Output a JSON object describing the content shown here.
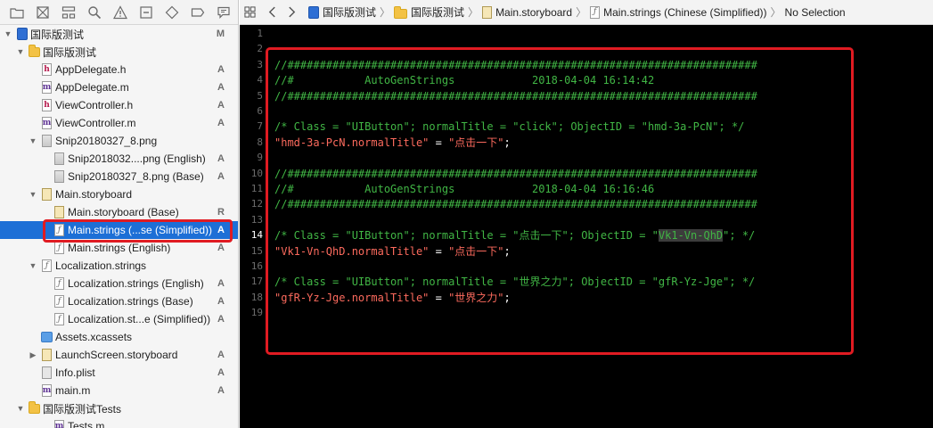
{
  "navigator": {
    "toolbar_icons": [
      "folder-icon",
      "source-control-icon",
      "hierarchy-icon",
      "search-icon",
      "warning-icon",
      "test-icon",
      "debug-icon",
      "breakpoint-icon",
      "report-icon"
    ],
    "items": [
      {
        "label": "国际版测试",
        "badge": "M",
        "icon": "project-icon",
        "disclosure": "open"
      },
      {
        "label": "国际版测试",
        "badge": "",
        "icon": "folder-icon",
        "disclosure": "open"
      },
      {
        "label": "AppDelegate.h",
        "badge": "A",
        "icon": "header-file-icon",
        "disclosure": ""
      },
      {
        "label": "AppDelegate.m",
        "badge": "A",
        "icon": "objc-file-icon",
        "disclosure": ""
      },
      {
        "label": "ViewController.h",
        "badge": "A",
        "icon": "header-file-icon",
        "disclosure": ""
      },
      {
        "label": "ViewController.m",
        "badge": "A",
        "icon": "objc-file-icon",
        "disclosure": ""
      },
      {
        "label": "Snip20180327_8.png",
        "badge": "",
        "icon": "image-file-icon",
        "disclosure": "open"
      },
      {
        "label": "Snip2018032....png (English)",
        "badge": "A",
        "icon": "image-file-icon",
        "disclosure": ""
      },
      {
        "label": "Snip20180327_8.png (Base)",
        "badge": "A",
        "icon": "image-file-icon",
        "disclosure": ""
      },
      {
        "label": "Main.storyboard",
        "badge": "",
        "icon": "storyboard-file-icon",
        "disclosure": "open"
      },
      {
        "label": "Main.storyboard (Base)",
        "badge": "R",
        "icon": "storyboard-file-icon",
        "disclosure": ""
      },
      {
        "label": "Main.strings (...se (Simplified))",
        "badge": "A",
        "icon": "strings-file-icon",
        "disclosure": "",
        "selected": true
      },
      {
        "label": "Main.strings (English)",
        "badge": "A",
        "icon": "strings-file-icon",
        "disclosure": ""
      },
      {
        "label": "Localization.strings",
        "badge": "",
        "icon": "strings-file-icon",
        "disclosure": "open"
      },
      {
        "label": "Localization.strings (English)",
        "badge": "A",
        "icon": "strings-file-icon",
        "disclosure": ""
      },
      {
        "label": "Localization.strings (Base)",
        "badge": "A",
        "icon": "strings-file-icon",
        "disclosure": ""
      },
      {
        "label": "Localization.st...e (Simplified))",
        "badge": "A",
        "icon": "strings-file-icon",
        "disclosure": ""
      },
      {
        "label": "Assets.xcassets",
        "badge": "",
        "icon": "assets-icon",
        "disclosure": ""
      },
      {
        "label": "LaunchScreen.storyboard",
        "badge": "A",
        "icon": "storyboard-file-icon",
        "disclosure": "closed"
      },
      {
        "label": "Info.plist",
        "badge": "A",
        "icon": "plist-file-icon",
        "disclosure": ""
      },
      {
        "label": "main.m",
        "badge": "A",
        "icon": "objc-file-icon",
        "disclosure": ""
      },
      {
        "label": "国际版测试Tests",
        "badge": "",
        "icon": "folder-icon",
        "disclosure": "open"
      },
      {
        "label": "Tests.m",
        "badge": "",
        "icon": "objc-file-icon",
        "disclosure": ""
      }
    ]
  },
  "jumpbar": {
    "crumbs": [
      {
        "label": "国际版测试",
        "icon": "project-icon"
      },
      {
        "label": "国际版测试",
        "icon": "folder-icon"
      },
      {
        "label": "Main.storyboard",
        "icon": "storyboard-file-icon"
      },
      {
        "label": "Main.strings (Chinese (Simplified))",
        "icon": "strings-file-icon"
      },
      {
        "label": "No Selection",
        "icon": ""
      }
    ]
  },
  "editor": {
    "current_line": 14,
    "lines": [
      {
        "n": 1,
        "parts": []
      },
      {
        "n": 2,
        "parts": []
      },
      {
        "n": 3,
        "parts": [
          {
            "t": "//#########################################################################",
            "c": "comment"
          }
        ]
      },
      {
        "n": 4,
        "parts": [
          {
            "t": "//#           AutoGenStrings            2018-04-04 16:14:42",
            "c": "comment"
          }
        ]
      },
      {
        "n": 5,
        "parts": [
          {
            "t": "//#########################################################################",
            "c": "comment"
          }
        ]
      },
      {
        "n": 6,
        "parts": []
      },
      {
        "n": 7,
        "parts": [
          {
            "t": "/* Class = \"UIButton\"; normalTitle = \"click\"; ObjectID = \"hmd-3a-PcN\"; */",
            "c": "comment"
          }
        ]
      },
      {
        "n": 8,
        "parts": [
          {
            "t": "\"hmd-3a-PcN.normalTitle\"",
            "c": "string"
          },
          {
            "t": " = ",
            "c": "plain"
          },
          {
            "t": "\"点击一下\"",
            "c": "string"
          },
          {
            "t": ";",
            "c": "plain"
          }
        ]
      },
      {
        "n": 9,
        "parts": []
      },
      {
        "n": 10,
        "parts": [
          {
            "t": "//#########################################################################",
            "c": "comment"
          }
        ]
      },
      {
        "n": 11,
        "parts": [
          {
            "t": "//#           AutoGenStrings            2018-04-04 16:16:46",
            "c": "comment"
          }
        ]
      },
      {
        "n": 12,
        "parts": [
          {
            "t": "//#########################################################################",
            "c": "comment"
          }
        ]
      },
      {
        "n": 13,
        "parts": []
      },
      {
        "n": 14,
        "parts": [
          {
            "t": "/* Class = \"UIButton\"; normalTitle = \"点击一下\"; ObjectID = \"",
            "c": "comment"
          },
          {
            "t": "Vk1-Vn-QhD",
            "c": "highlight"
          },
          {
            "t": "\"; */",
            "c": "comment"
          }
        ]
      },
      {
        "n": 15,
        "parts": [
          {
            "t": "\"Vk1-Vn-QhD.normalTitle\"",
            "c": "string"
          },
          {
            "t": " = ",
            "c": "plain"
          },
          {
            "t": "\"点击一下\"",
            "c": "string"
          },
          {
            "t": ";",
            "c": "plain"
          }
        ]
      },
      {
        "n": 16,
        "parts": []
      },
      {
        "n": 17,
        "parts": [
          {
            "t": "/* Class = \"UIButton\"; normalTitle = \"世界之力\"; ObjectID = \"gfR-Yz-Jge\"; */",
            "c": "comment"
          }
        ]
      },
      {
        "n": 18,
        "parts": [
          {
            "t": "\"gfR-Yz-Jge.normalTitle\"",
            "c": "string"
          },
          {
            "t": " = ",
            "c": "plain"
          },
          {
            "t": "\"世界之力\"",
            "c": "string"
          },
          {
            "t": ";",
            "c": "plain"
          }
        ]
      },
      {
        "n": 19,
        "parts": []
      }
    ]
  },
  "colors": {
    "selection": "#1d6fd6",
    "annotation_red": "#e01b22",
    "comment_green": "#41b645",
    "string_red": "#fc6a5d",
    "editor_bg": "#000000"
  }
}
